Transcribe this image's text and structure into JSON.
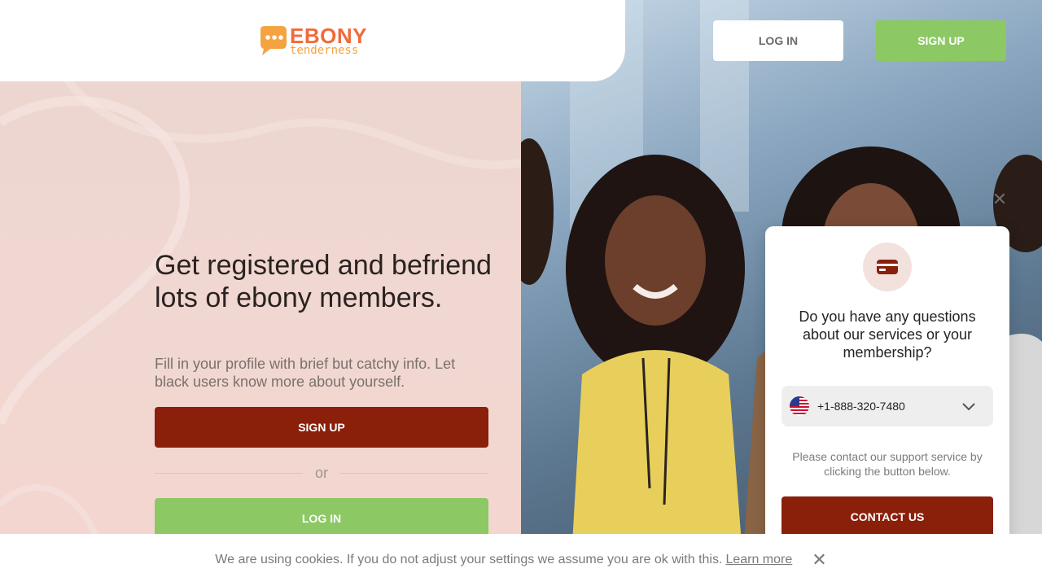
{
  "header": {
    "logo_main": "EBONY",
    "logo_sub": "tenderness",
    "login_label": "LOG IN",
    "signup_label": "SIGN UP"
  },
  "hero": {
    "title": "Get registered and befriend lots of ebony members.",
    "subtitle": "Fill in your profile with brief but catchy info. Let black users know more about yourself.",
    "signup_label": "SIGN UP",
    "or_label": "or",
    "login_label": "LOG IN"
  },
  "support_widget": {
    "close_icon": "close-icon",
    "icon": "credit-card-icon",
    "title": "Do you have any questions about our services or your membership?",
    "phone_flag": "us-flag-icon",
    "phone_number": "+1-888-320-7480",
    "note": "Please contact our support service by clicking the button below.",
    "contact_label": "CONTACT US"
  },
  "cookie_bar": {
    "text": "We are using cookies. If you do not adjust your settings we assume you are ok with this.",
    "link_label": "Learn more",
    "close_icon": "close-icon"
  },
  "colors": {
    "brand_orange": "#f16a3a",
    "brand_dark_red": "#8a1f0a",
    "brand_green": "#8cc864",
    "panel_pink": "#f1d7d1"
  }
}
